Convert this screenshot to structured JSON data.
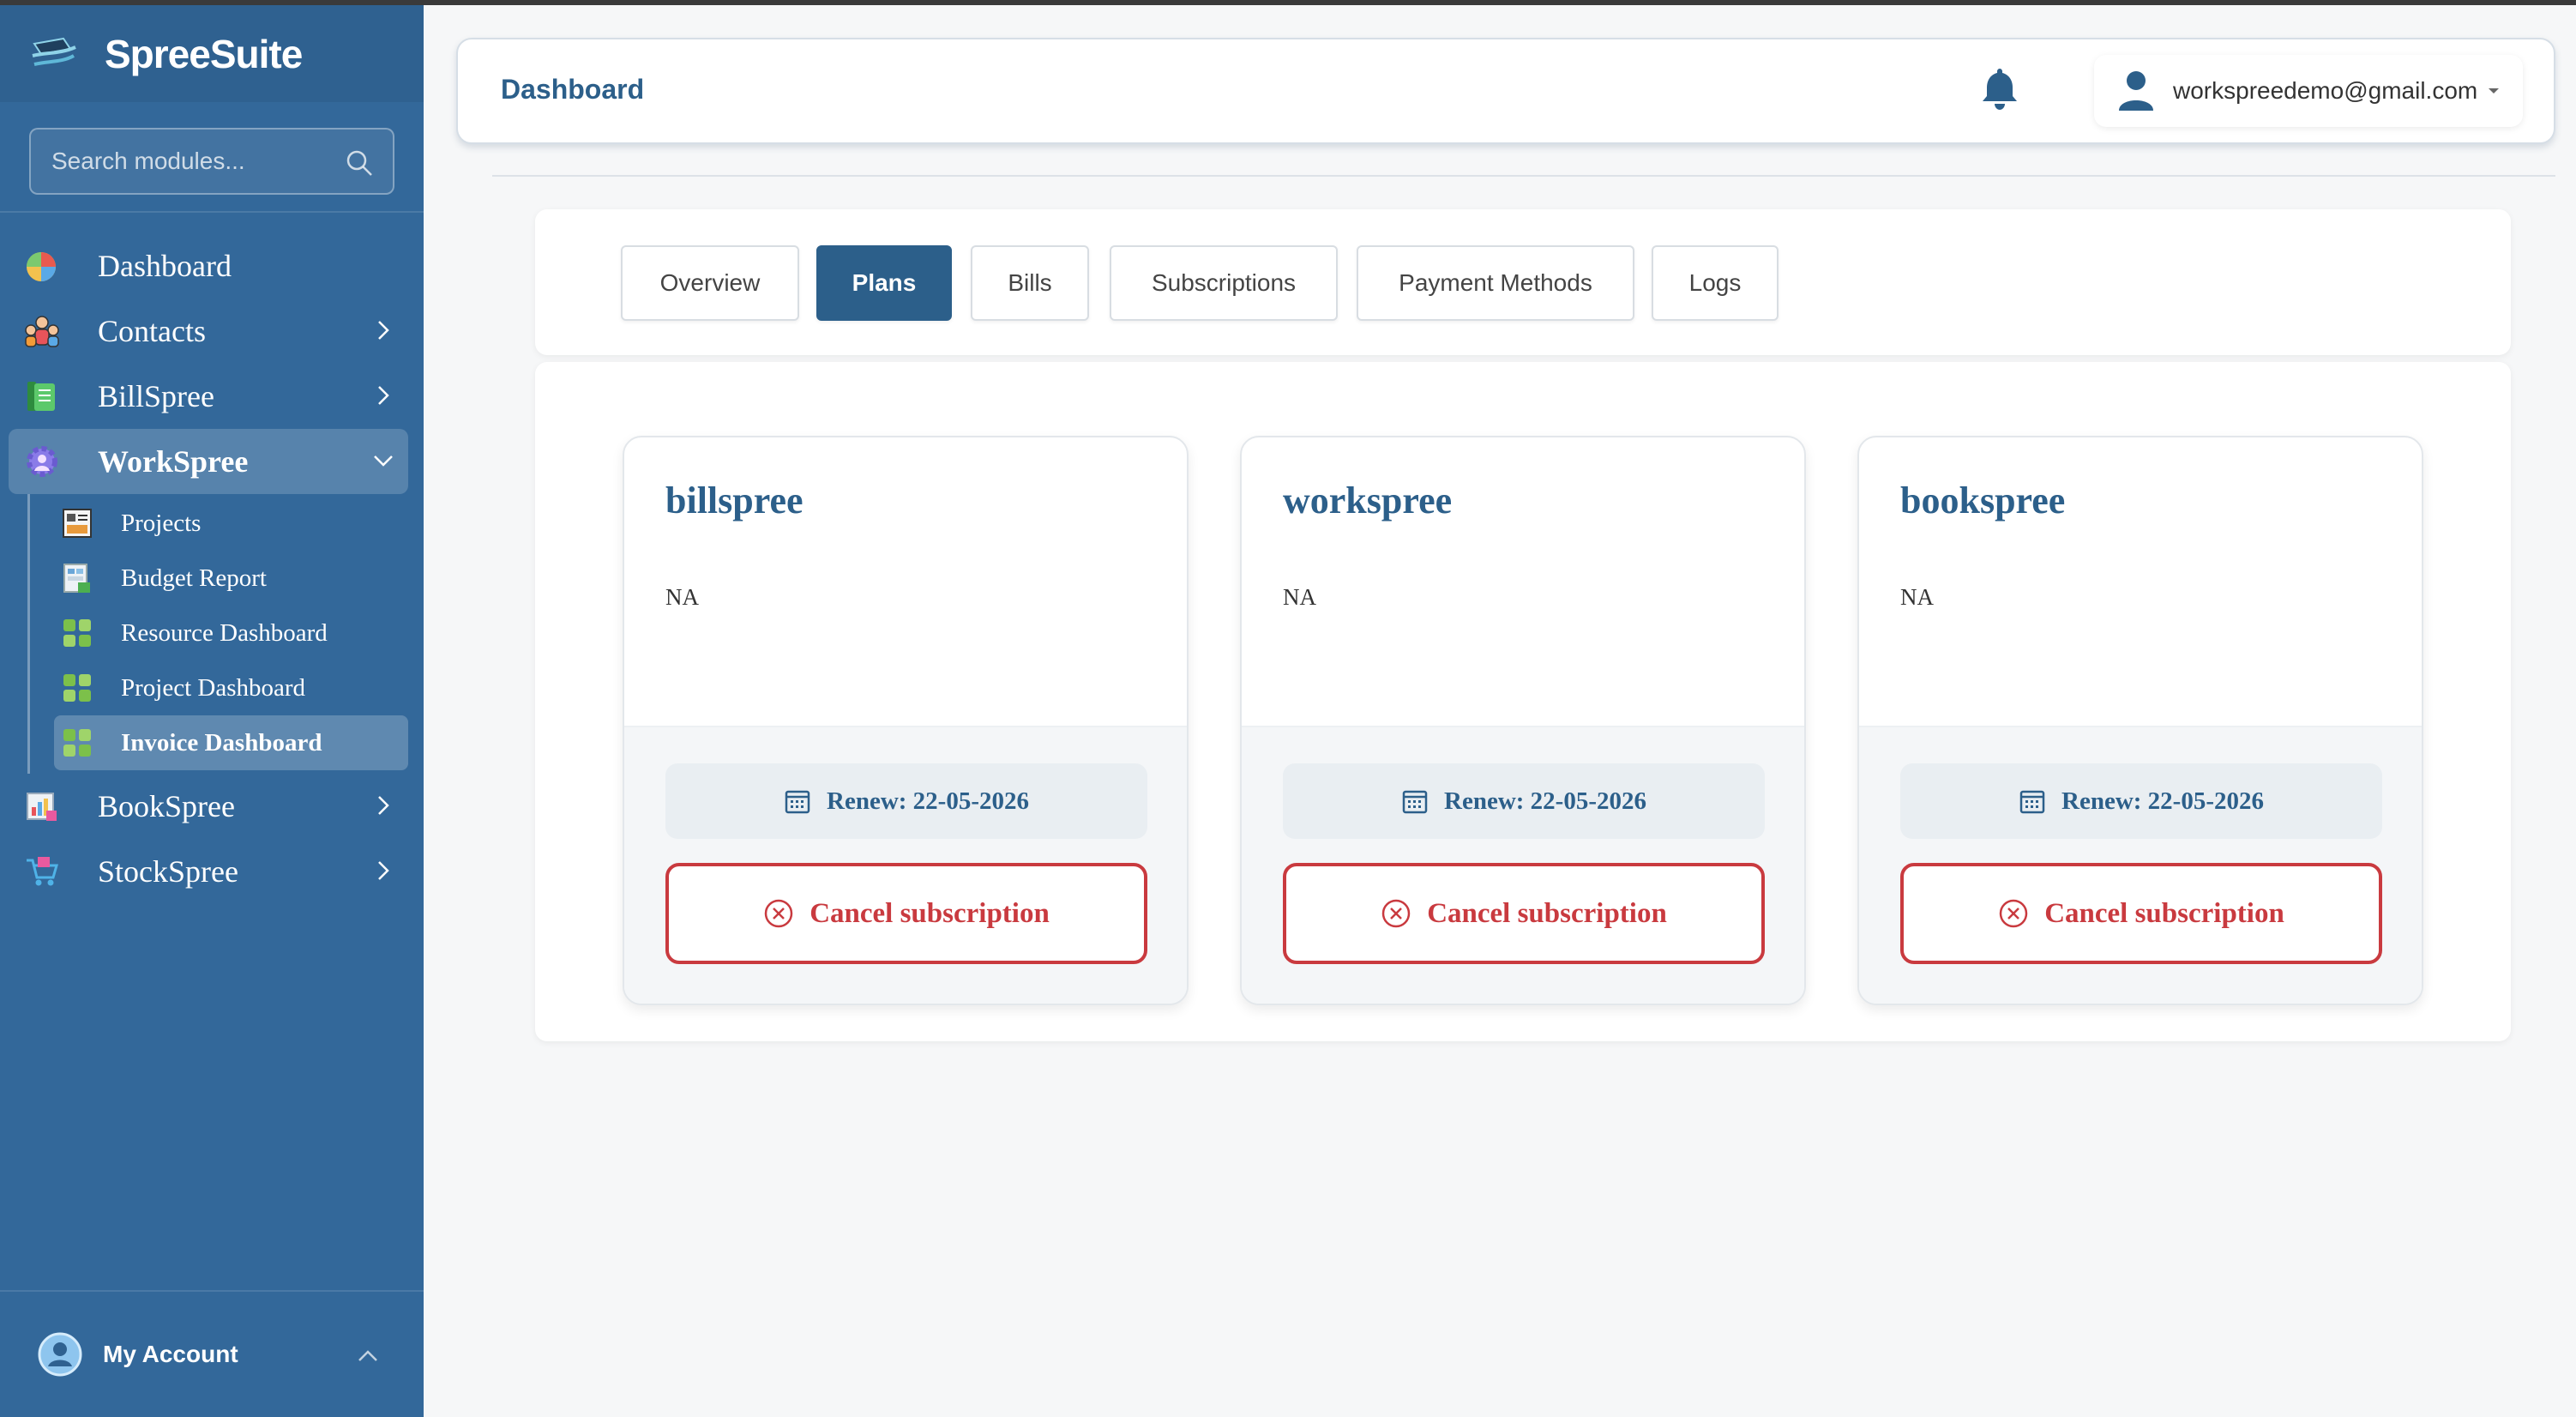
{
  "sidebar": {
    "brand": "SpreeSuite",
    "search_placeholder": "Search modules...",
    "nav": {
      "dashboard": "Dashboard",
      "contacts": "Contacts",
      "billspree": "BillSpree",
      "workspree": "WorkSpree",
      "bookspree": "BookSpree",
      "stockspree": "StockSpree"
    },
    "workspree_sub": [
      "Projects",
      "Budget Report",
      "Resource Dashboard",
      "Project Dashboard",
      "Invoice Dashboard"
    ],
    "account_label": "My Account"
  },
  "header": {
    "title": "Dashboard",
    "user_email": "workspreedemo@gmail.com"
  },
  "tabs": [
    "Overview",
    "Plans",
    "Bills",
    "Subscriptions",
    "Payment Methods",
    "Logs"
  ],
  "active_tab": "Plans",
  "plans": [
    {
      "name": "billspree",
      "desc": "NA",
      "renew": "Renew: 22-05-2026",
      "cancel": "Cancel subscription"
    },
    {
      "name": "workspree",
      "desc": "NA",
      "renew": "Renew: 22-05-2026",
      "cancel": "Cancel subscription"
    },
    {
      "name": "bookspree",
      "desc": "NA",
      "renew": "Renew: 22-05-2026",
      "cancel": "Cancel subscription"
    }
  ],
  "colors": {
    "sidebar": "#33689a",
    "primary": "#2c5f8a",
    "danger": "#c93a3f"
  }
}
